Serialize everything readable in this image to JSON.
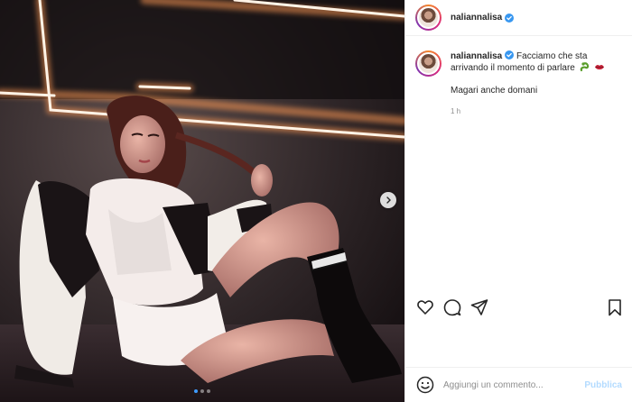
{
  "post": {
    "author": "naliannalisa",
    "verified": true,
    "caption": {
      "line1": "Facciamo che sta",
      "line2": "arrivando il momento di parlare",
      "extra": "Magari anche domani",
      "emojis": [
        "snake-icon",
        "lips-icon"
      ]
    },
    "time_ago": "1 h",
    "carousel": {
      "slides": 3,
      "active_slide": 1
    }
  },
  "comment": {
    "placeholder": "Aggiungi un commento...",
    "publish_label": "Pubblica"
  },
  "colors": {
    "verified_blue": "#3897f0",
    "link_disabled": "#b3dbff",
    "neon": "#ffd9b0",
    "border": "#efefef"
  }
}
